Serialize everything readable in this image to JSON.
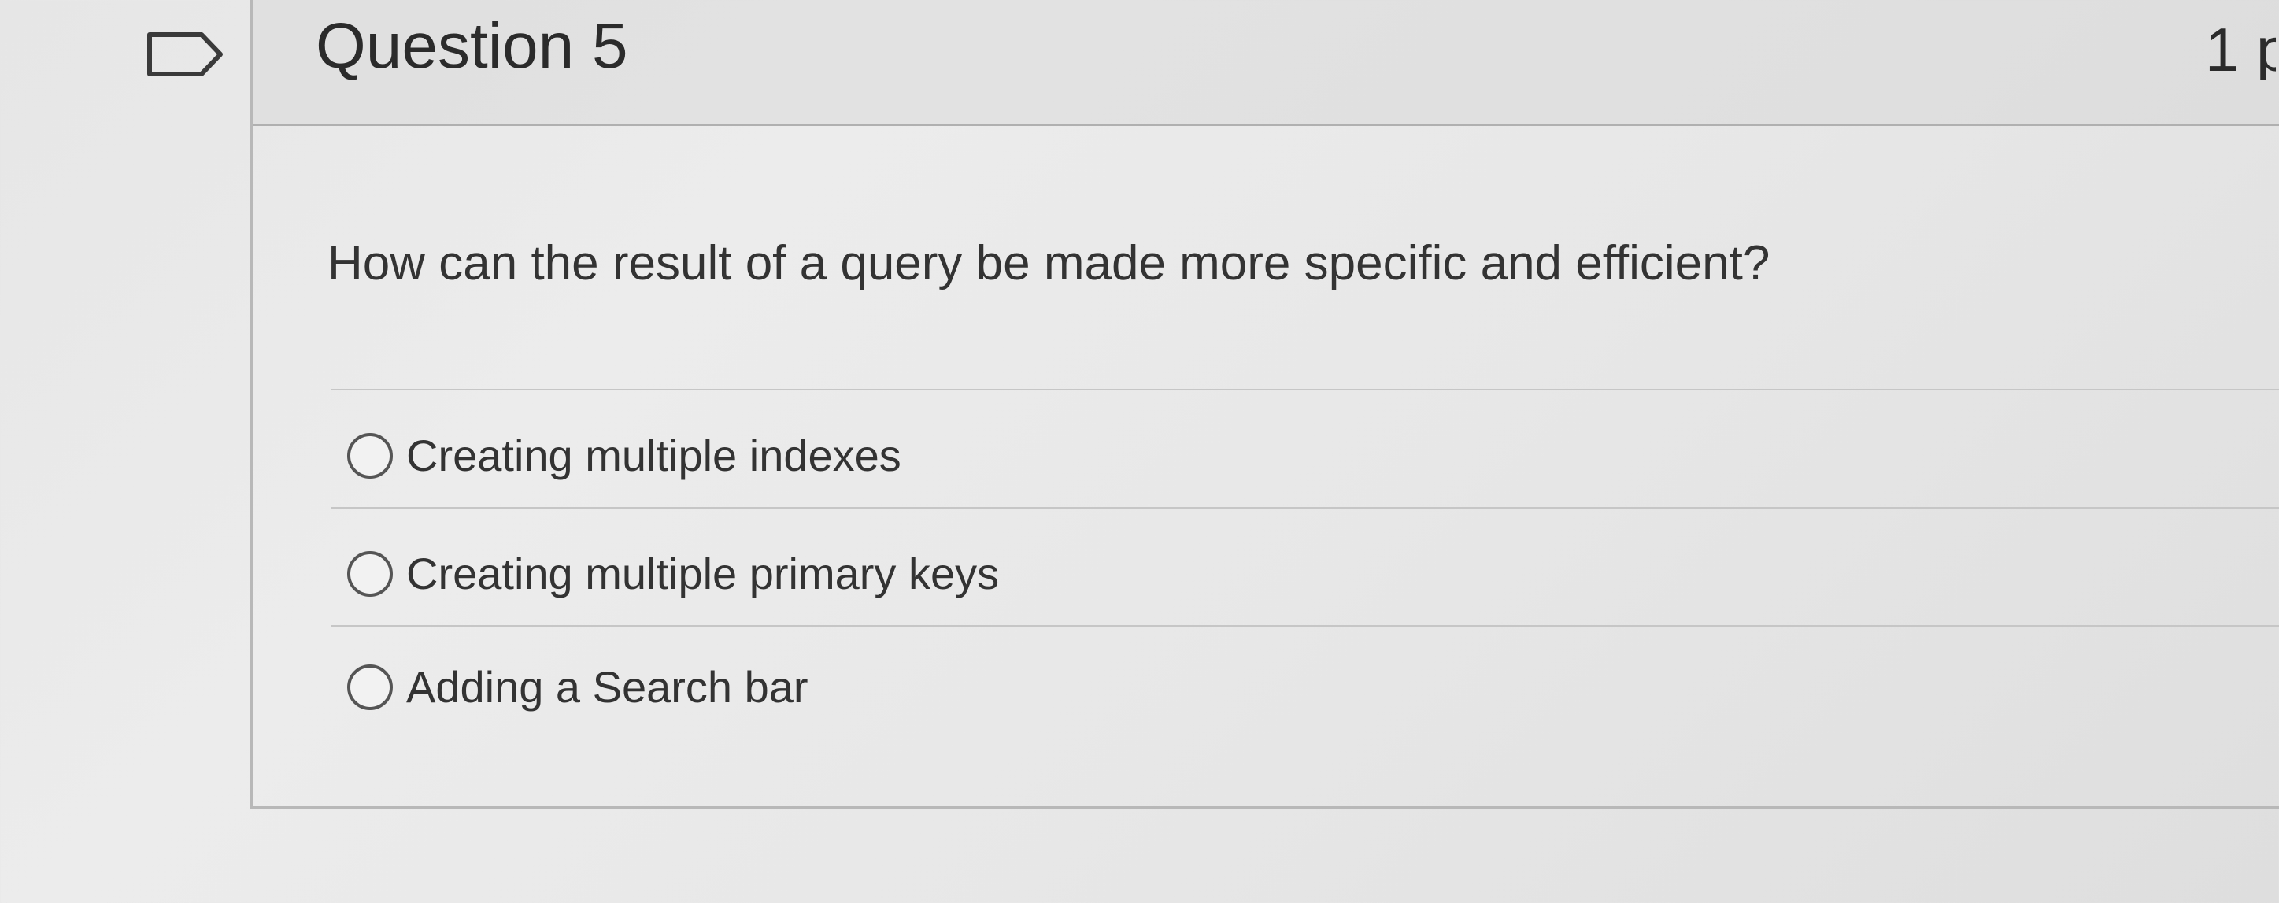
{
  "question": {
    "title": "Question 5",
    "points": "1 p",
    "text": "How can the result of a query be made more specific and efficient?",
    "answers": [
      {
        "label": "Creating multiple indexes",
        "selected": false
      },
      {
        "label": "Creating multiple primary keys",
        "selected": false
      },
      {
        "label": "Adding a Search bar",
        "selected": false
      }
    ]
  },
  "icons": {
    "flag": "flag-icon",
    "radio": "radio-button-icon"
  }
}
